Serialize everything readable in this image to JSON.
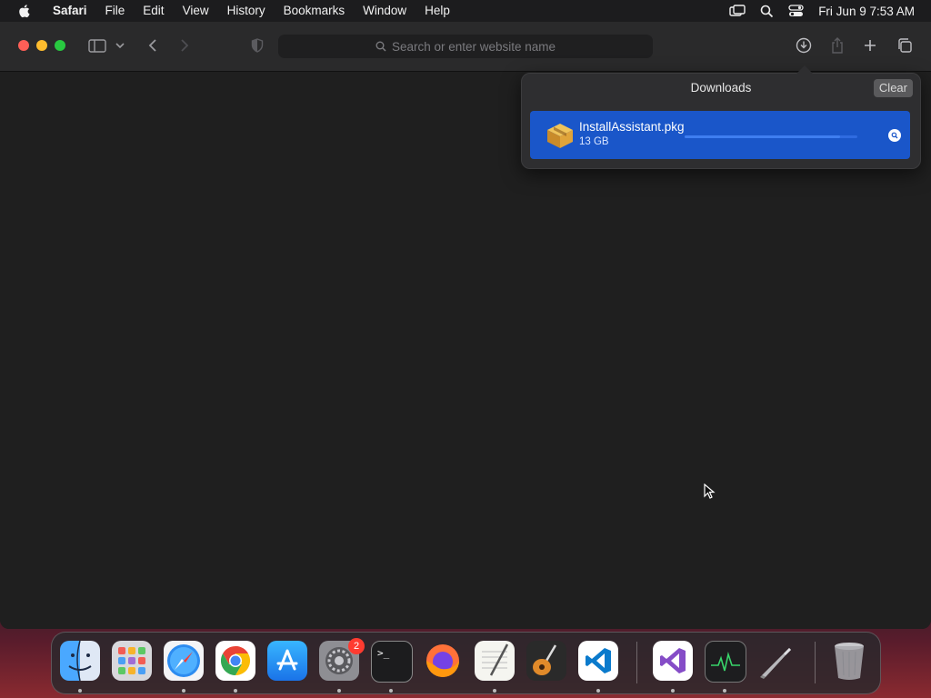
{
  "menubar": {
    "app_name": "Safari",
    "items": [
      "File",
      "Edit",
      "View",
      "History",
      "Bookmarks",
      "Window",
      "Help"
    ],
    "clock": "Fri Jun 9  7:53 AM"
  },
  "toolbar": {
    "address_placeholder": "Search or enter website name"
  },
  "downloads": {
    "title": "Downloads",
    "clear_label": "Clear",
    "items": [
      {
        "name": "InstallAssistant.pkg",
        "size": "13 GB",
        "progress": 0.9,
        "icon": "package-icon"
      }
    ]
  },
  "dock": {
    "apps": [
      {
        "name": "Finder",
        "icon": "finder-icon"
      },
      {
        "name": "Launchpad",
        "icon": "launchpad-icon"
      },
      {
        "name": "Safari",
        "icon": "safari-icon"
      },
      {
        "name": "Google Chrome",
        "icon": "chrome-icon"
      },
      {
        "name": "App Store",
        "icon": "app-store-icon"
      },
      {
        "name": "System Settings",
        "icon": "settings-icon",
        "badge": "2"
      },
      {
        "name": "Terminal",
        "icon": "terminal-icon"
      },
      {
        "name": "Firefox",
        "icon": "firefox-icon"
      },
      {
        "name": "TextEdit",
        "icon": "textedit-icon"
      },
      {
        "name": "GarageBand",
        "icon": "garageband-icon"
      },
      {
        "name": "Visual Studio Code",
        "icon": "vscode-icon"
      },
      {
        "name": "Visual Studio",
        "icon": "visual-studio-icon"
      },
      {
        "name": "Activity Monitor",
        "icon": "activity-monitor-icon"
      },
      {
        "name": "Install macOS",
        "icon": "installer-icon"
      },
      {
        "name": "Trash",
        "icon": "trash-icon"
      }
    ]
  }
}
